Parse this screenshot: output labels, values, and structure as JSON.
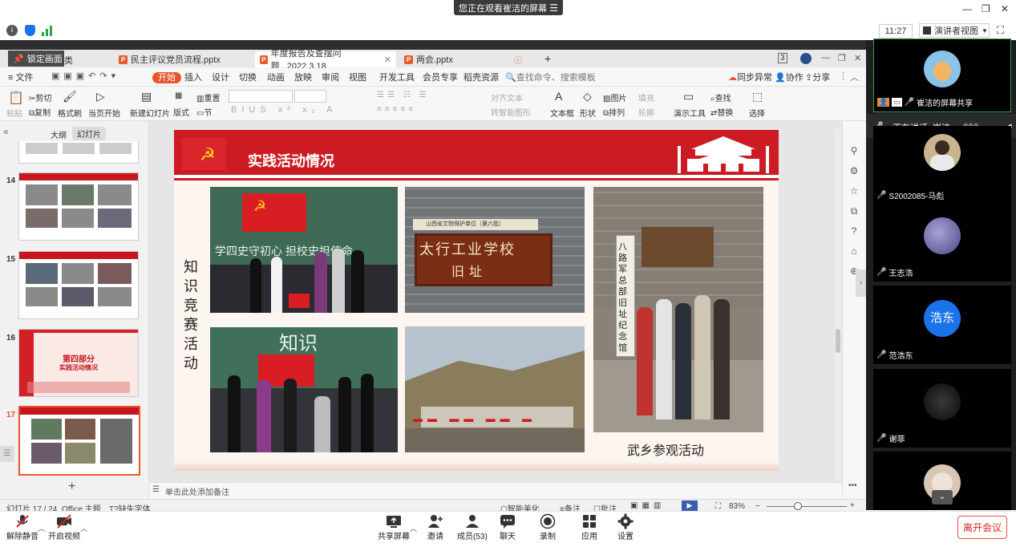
{
  "meeting": {
    "share_banner": "您正在观看崔洁的屏幕",
    "time": "11:27",
    "view_mode": "演讲者视图",
    "speaking": "正在讲话: 崔洁;",
    "bottom": {
      "unmute": "解除静音",
      "video": "开启视频",
      "share": "共享屏幕",
      "invite": "邀请",
      "members": "成员(53)",
      "chat": "聊天",
      "record": "录制",
      "apps": "应用",
      "settings": "设置",
      "leave": "离开会议"
    },
    "participants": [
      {
        "name": "崔洁的屏幕共享",
        "avatar": "cat-avatar"
      },
      {
        "name": "S2002085-马彪",
        "avatar": "photo-avatar"
      },
      {
        "name": "王志浩",
        "avatar": "sky-avatar"
      },
      {
        "name": "范浩东",
        "avatar": "text-avatar",
        "initials": "浩东"
      },
      {
        "name": "谢菲",
        "avatar": "dark-avatar"
      },
      {
        "name": "",
        "avatar": "face-avatar"
      }
    ]
  },
  "wps": {
    "lock_label": "锁定画面",
    "partial_tab": "类",
    "tabs": [
      {
        "label": "民主评议党员流程.pptx"
      },
      {
        "label": "年度报告及查摆问题...2022.3.18"
      },
      {
        "label": "两会.pptx"
      }
    ],
    "file_menu": "文件",
    "menus": [
      "开始",
      "插入",
      "设计",
      "切换",
      "动画",
      "放映",
      "审阅",
      "视图",
      "开发工具",
      "会员专享",
      "稻壳资源"
    ],
    "search_placeholder": "查找命令、搜索模板",
    "sync": "同步异常",
    "collab": "协作",
    "share": "分享",
    "ribbon": {
      "paste": "粘贴",
      "cut": "剪切",
      "copy": "复制",
      "format_painter": "格式刷",
      "play_from": "当页开始",
      "new_slide": "新建幻灯片",
      "layout": "版式",
      "section": "节",
      "reset": "重置",
      "align_text": "对齐文本",
      "smartart": "转智能图形",
      "textbox": "文本框",
      "shape": "形状",
      "picture": "图片",
      "arrange": "排列",
      "fill": "填充",
      "outline": "轮廓",
      "present_tools": "演示工具",
      "find": "查找",
      "replace": "替换",
      "select": "选择"
    },
    "panel_tabs": [
      "大纲",
      "幻灯片"
    ],
    "thumbs": [
      {
        "num": "14"
      },
      {
        "num": "15"
      },
      {
        "num": "16",
        "title": "第四部分",
        "subtitle": "实践活动情况"
      },
      {
        "num": "17"
      }
    ],
    "slide": {
      "title": "实践活动情况",
      "side_text": "知识竞赛活动",
      "caption": "武乡参观活动",
      "board_text": "学四史守初心 担校史担使命",
      "board_text2": "知识",
      "sign_main": "太行工业学校",
      "sign_sub": "旧址",
      "plaque": "山西省文物保护单位（第六批）",
      "memorial": "八路军总部旧址纪念馆"
    },
    "notes_placeholder": "单击此处添加备注",
    "status": {
      "slide_count": "幻灯片 17 / 24",
      "theme": "Office 主题",
      "missing_font": "缺失字体",
      "smart": "智能美化",
      "notes": "备注",
      "comments": "批注",
      "zoom": "83%"
    }
  },
  "colors": {
    "accent": "#e8552d",
    "slide_red": "#cc1b22"
  }
}
